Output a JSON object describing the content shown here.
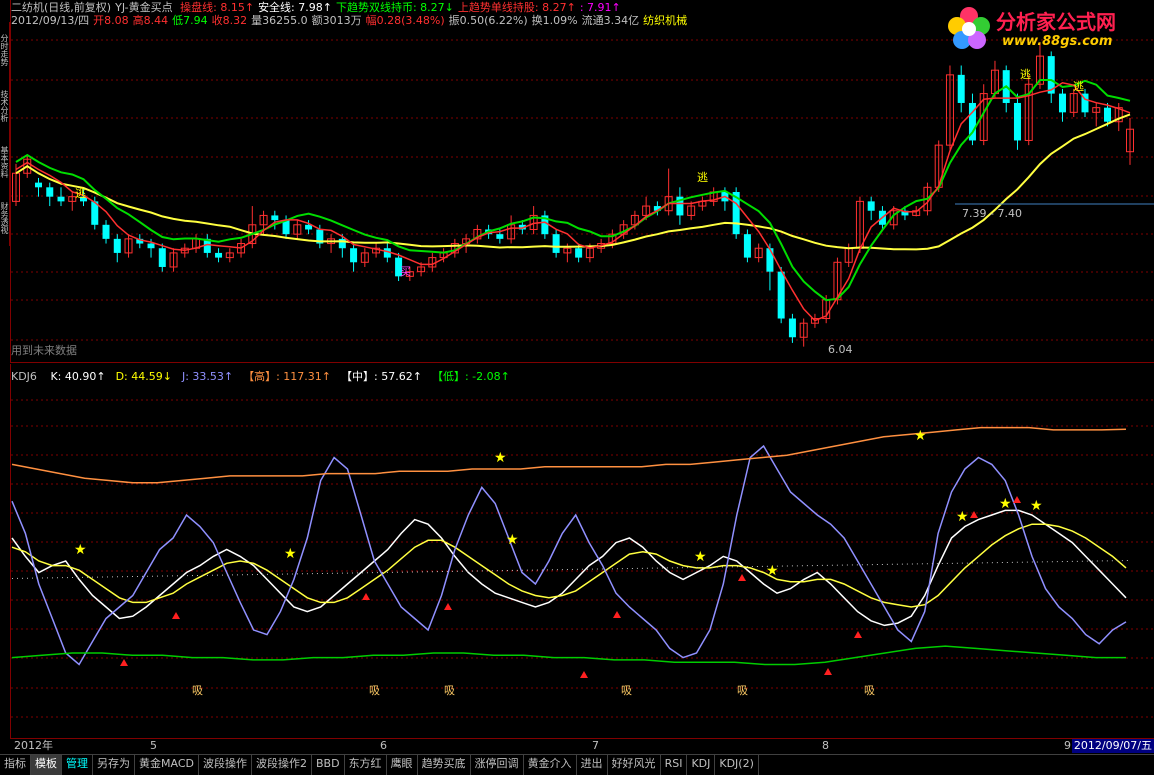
{
  "header": {
    "title": "二纺机(日线,前复权)",
    "indicator": "YJ-黄金买点",
    "items": [
      {
        "label": "操盘线:",
        "value": "8.15",
        "arrow": "↑",
        "color": "#ff3030"
      },
      {
        "label": "安全线:",
        "value": "7.98",
        "arrow": "↑",
        "color": "#ffffff"
      },
      {
        "label": "下趋势双线持币:",
        "value": "8.27",
        "arrow": "↓",
        "color": "#00ff00"
      },
      {
        "label": "上趋势单线持股:",
        "value": "8.27",
        "arrow": "↑",
        "color": "#ff3030"
      },
      {
        "label": ":",
        "value": "7.91",
        "arrow": "↑",
        "color": "#ff00ff"
      }
    ],
    "line2": [
      {
        "text": "2012/09/13/四",
        "color": "#c0c0c0"
      },
      {
        "text": "开8.08",
        "color": "#ff3030"
      },
      {
        "text": "高8.44",
        "color": "#ff3030"
      },
      {
        "text": "低7.94",
        "color": "#00ff00"
      },
      {
        "text": "收8.32",
        "color": "#ff3030"
      },
      {
        "text": "量36255.0",
        "color": "#c0c0c0"
      },
      {
        "text": "额3013万",
        "color": "#c0c0c0"
      },
      {
        "text": "幅0.28(3.48%)",
        "color": "#ff3030"
      },
      {
        "text": "振0.50(6.22%)",
        "color": "#c0c0c0"
      },
      {
        "text": "换1.09%",
        "color": "#c0c0c0"
      },
      {
        "text": "流通3.34亿",
        "color": "#c0c0c0"
      },
      {
        "text": "纺织机械",
        "color": "#ffff00"
      }
    ]
  },
  "side_tabs": [
    "分时走势",
    "技术分析",
    "基本资料",
    "财务透视"
  ],
  "main_annotations": {
    "future_note": "用到未来数据",
    "low_label": "6.04",
    "range_label": "7.39 - 7.40",
    "escape_labels": [
      "逃",
      "逃",
      "逃",
      "逃"
    ],
    "buy_label": "买"
  },
  "kdj_header": {
    "name": "KDJ6",
    "items": [
      {
        "label": "K:",
        "value": "40.90",
        "arrow": "↑",
        "color": "#ffffff"
      },
      {
        "label": "D:",
        "value": "44.59",
        "arrow": "↓",
        "color": "#ffff00"
      },
      {
        "label": "J:",
        "value": "33.53",
        "arrow": "↑",
        "color": "#9090ff"
      },
      {
        "label": "【高】:",
        "value": "117.31",
        "arrow": "↑",
        "color": "#ff9040"
      },
      {
        "label": "【中】:",
        "value": "57.62",
        "arrow": "↑",
        "color": "#ffffff"
      },
      {
        "label": "【低】:",
        "value": "-2.08",
        "arrow": "↑",
        "color": "#00ff00"
      }
    ],
    "xi_label": "吸"
  },
  "date_axis": {
    "labels": [
      "2012年",
      "5",
      "6",
      "7",
      "8",
      "9"
    ],
    "current_date": "2012/09/07/五"
  },
  "bottom_tabs": [
    "指标",
    "模板",
    "管理",
    "另存为",
    "黄金MACD",
    "波段操作",
    "波段操作2",
    "BBD",
    "东方红",
    "鹰眼",
    "趋势买底",
    "涨停回调",
    "黄金介入",
    "进出",
    "好好风光",
    "RSI",
    "KDJ",
    "KDJ(2)"
  ],
  "logo": {
    "text": "分析家公式网",
    "url_text": "www.88gs.com"
  },
  "colors": {
    "up": "#ff3030",
    "down": "#00ffff",
    "ma_yellow": "#ffff40",
    "green": "#00dd00",
    "grid": "#800000"
  },
  "chart_data": [
    {
      "type": "candlestick",
      "title": "二纺机(日线,前复权)",
      "ylim": [
        5.9,
        9.4
      ],
      "note": "approximate OHLC sequence, Apr–Sep 2012",
      "candles": [
        [
          7.55,
          7.85,
          7.95,
          7.5
        ],
        [
          7.85,
          8.0,
          8.05,
          7.8
        ],
        [
          7.75,
          7.7,
          7.8,
          7.6
        ],
        [
          7.7,
          7.6,
          7.75,
          7.5
        ],
        [
          7.6,
          7.55,
          7.7,
          7.5
        ],
        [
          7.55,
          7.6,
          7.65,
          7.45
        ],
        [
          7.6,
          7.55,
          7.7,
          7.5
        ],
        [
          7.55,
          7.3,
          7.6,
          7.25
        ],
        [
          7.3,
          7.15,
          7.35,
          7.1
        ],
        [
          7.15,
          7.0,
          7.2,
          6.9
        ],
        [
          7.0,
          7.15,
          7.2,
          6.95
        ],
        [
          7.15,
          7.1,
          7.2,
          7.05
        ],
        [
          7.1,
          7.05,
          7.15,
          6.95
        ],
        [
          7.05,
          6.85,
          7.1,
          6.8
        ],
        [
          6.85,
          7.0,
          7.05,
          6.8
        ],
        [
          7.0,
          7.05,
          7.1,
          6.95
        ],
        [
          7.05,
          7.15,
          7.2,
          7.0
        ],
        [
          7.15,
          7.0,
          7.2,
          6.95
        ],
        [
          7.0,
          6.95,
          7.05,
          6.9
        ],
        [
          6.95,
          7.0,
          7.05,
          6.9
        ],
        [
          7.0,
          7.1,
          7.15,
          6.95
        ],
        [
          7.1,
          7.3,
          7.5,
          7.05
        ],
        [
          7.3,
          7.4,
          7.45,
          7.2
        ],
        [
          7.4,
          7.35,
          7.45,
          7.25
        ],
        [
          7.35,
          7.2,
          7.4,
          7.15
        ],
        [
          7.2,
          7.3,
          7.35,
          7.15
        ],
        [
          7.3,
          7.25,
          7.35,
          7.2
        ],
        [
          7.25,
          7.1,
          7.3,
          7.05
        ],
        [
          7.1,
          7.15,
          7.2,
          7.0
        ],
        [
          7.15,
          7.05,
          7.2,
          6.95
        ],
        [
          7.05,
          6.9,
          7.1,
          6.8
        ],
        [
          6.9,
          7.0,
          7.05,
          6.85
        ],
        [
          7.0,
          7.05,
          7.1,
          6.95
        ],
        [
          7.05,
          6.95,
          7.1,
          6.9
        ],
        [
          6.95,
          6.75,
          7.0,
          6.7
        ],
        [
          6.75,
          6.8,
          6.85,
          6.7
        ],
        [
          6.8,
          6.85,
          6.9,
          6.75
        ],
        [
          6.85,
          6.95,
          7.0,
          6.8
        ],
        [
          6.95,
          7.0,
          7.05,
          6.9
        ],
        [
          7.0,
          7.1,
          7.15,
          6.95
        ],
        [
          7.1,
          7.15,
          7.2,
          7.0
        ],
        [
          7.15,
          7.25,
          7.3,
          7.1
        ],
        [
          7.25,
          7.2,
          7.3,
          7.15
        ],
        [
          7.2,
          7.15,
          7.25,
          7.1
        ],
        [
          7.15,
          7.3,
          7.4,
          7.1
        ],
        [
          7.3,
          7.25,
          7.35,
          7.2
        ],
        [
          7.25,
          7.4,
          7.5,
          7.2
        ],
        [
          7.4,
          7.2,
          7.45,
          7.15
        ],
        [
          7.2,
          7.0,
          7.25,
          6.95
        ],
        [
          7.0,
          7.05,
          7.1,
          6.9
        ],
        [
          7.05,
          6.95,
          7.1,
          6.9
        ],
        [
          6.95,
          7.05,
          7.1,
          6.9
        ],
        [
          7.05,
          7.1,
          7.15,
          7.0
        ],
        [
          7.1,
          7.2,
          7.25,
          7.05
        ],
        [
          7.2,
          7.3,
          7.35,
          7.15
        ],
        [
          7.3,
          7.4,
          7.45,
          7.25
        ],
        [
          7.4,
          7.5,
          7.6,
          7.35
        ],
        [
          7.5,
          7.45,
          7.55,
          7.4
        ],
        [
          7.45,
          7.6,
          7.9,
          7.4
        ],
        [
          7.6,
          7.4,
          7.7,
          7.3
        ],
        [
          7.4,
          7.5,
          7.55,
          7.35
        ],
        [
          7.5,
          7.55,
          7.6,
          7.45
        ],
        [
          7.55,
          7.65,
          7.7,
          7.5
        ],
        [
          7.65,
          7.55,
          7.7,
          7.45
        ],
        [
          7.65,
          7.2,
          7.7,
          7.15
        ],
        [
          7.2,
          6.95,
          7.25,
          6.9
        ],
        [
          6.95,
          7.05,
          7.1,
          6.9
        ],
        [
          7.05,
          6.8,
          7.1,
          6.6
        ],
        [
          6.8,
          6.3,
          6.85,
          6.25
        ],
        [
          6.3,
          6.1,
          6.35,
          6.04
        ],
        [
          6.1,
          6.25,
          6.3,
          6.0
        ],
        [
          6.25,
          6.3,
          6.35,
          6.2
        ],
        [
          6.3,
          6.5,
          6.55,
          6.25
        ],
        [
          6.5,
          6.9,
          6.95,
          6.45
        ],
        [
          6.9,
          7.05,
          7.1,
          6.85
        ],
        [
          7.05,
          7.55,
          7.6,
          7.0
        ],
        [
          7.55,
          7.45,
          7.6,
          7.35
        ],
        [
          7.45,
          7.3,
          7.5,
          7.25
        ],
        [
          7.3,
          7.45,
          7.5,
          7.25
        ],
        [
          7.45,
          7.4,
          7.5,
          7.35
        ],
        [
          7.4,
          7.45,
          7.5,
          7.39
        ],
        [
          7.45,
          7.7,
          7.75,
          7.4
        ],
        [
          7.7,
          8.15,
          8.2,
          7.65
        ],
        [
          8.15,
          8.9,
          9.0,
          8.1
        ],
        [
          8.9,
          8.6,
          9.0,
          8.5
        ],
        [
          8.6,
          8.2,
          8.7,
          8.15
        ],
        [
          8.2,
          8.7,
          8.8,
          8.15
        ],
        [
          8.7,
          8.95,
          9.05,
          8.65
        ],
        [
          8.95,
          8.6,
          9.0,
          8.5
        ],
        [
          8.6,
          8.2,
          8.7,
          8.1
        ],
        [
          8.2,
          8.8,
          8.9,
          8.15
        ],
        [
          8.8,
          9.1,
          9.25,
          8.75
        ],
        [
          9.1,
          8.7,
          9.15,
          8.6
        ],
        [
          8.7,
          8.5,
          8.75,
          8.4
        ],
        [
          8.5,
          8.7,
          8.75,
          8.45
        ],
        [
          8.7,
          8.5,
          8.75,
          8.45
        ],
        [
          8.5,
          8.55,
          8.6,
          8.35
        ],
        [
          8.55,
          8.4,
          8.6,
          8.35
        ],
        [
          8.4,
          8.55,
          8.6,
          8.3
        ],
        [
          8.08,
          8.32,
          8.44,
          7.94
        ]
      ]
    },
    {
      "type": "line",
      "title": "KDJ6",
      "ylim": [
        -10,
        130
      ],
      "series": [
        {
          "name": "K",
          "values": [
            70,
            62,
            55,
            58,
            60,
            52,
            45,
            40,
            35,
            36,
            40,
            45,
            50,
            55,
            58,
            62,
            65,
            62,
            58,
            52,
            46,
            40,
            38,
            40,
            45,
            50,
            55,
            60,
            65,
            72,
            78,
            76,
            70,
            62,
            55,
            50,
            46,
            44,
            42,
            40,
            42,
            46,
            52,
            58,
            62,
            68,
            70,
            66,
            60,
            55,
            52,
            55,
            58,
            62,
            60,
            55,
            50,
            46,
            48,
            52,
            55,
            50,
            44,
            38,
            34,
            32,
            33,
            36,
            45,
            58,
            70,
            75,
            78,
            80,
            82,
            82,
            80,
            76,
            72,
            68,
            62,
            56,
            50,
            44
          ]
        },
        {
          "name": "D",
          "values": [
            66,
            64,
            60,
            58,
            58,
            56,
            52,
            48,
            44,
            42,
            42,
            44,
            46,
            50,
            53,
            56,
            59,
            60,
            59,
            56,
            52,
            48,
            44,
            42,
            42,
            44,
            48,
            52,
            56,
            61,
            66,
            69,
            69,
            66,
            62,
            58,
            54,
            50,
            47,
            45,
            44,
            45,
            47,
            51,
            55,
            59,
            63,
            64,
            63,
            60,
            58,
            57,
            57,
            58,
            58,
            57,
            55,
            52,
            51,
            51,
            52,
            52,
            50,
            47,
            44,
            42,
            41,
            40,
            41,
            45,
            51,
            57,
            62,
            67,
            71,
            74,
            76,
            76,
            75,
            73,
            70,
            66,
            62,
            57
          ]
        },
        {
          "name": "J",
          "values": [
            86,
            72,
            50,
            35,
            20,
            15,
            25,
            35,
            40,
            45,
            55,
            65,
            70,
            80,
            75,
            68,
            55,
            42,
            30,
            28,
            38,
            52,
            70,
            95,
            105,
            100,
            80,
            60,
            50,
            40,
            35,
            30,
            45,
            65,
            80,
            92,
            85,
            70,
            55,
            50,
            60,
            72,
            80,
            68,
            58,
            46,
            40,
            35,
            30,
            22,
            18,
            20,
            30,
            50,
            80,
            105,
            110,
            100,
            90,
            85,
            80,
            76,
            70,
            60,
            50,
            40,
            30,
            25,
            38,
            72,
            90,
            100,
            105,
            102,
            95,
            80,
            62,
            48,
            40,
            35,
            28,
            24,
            30,
            33.53
          ]
        },
        {
          "name": "高",
          "values": [
            102,
            100,
            98,
            96,
            95,
            94,
            94,
            95,
            96,
            97,
            97,
            97,
            97,
            98,
            98,
            98,
            99,
            99,
            99,
            100,
            100,
            100,
            101,
            101,
            101,
            101,
            101,
            102,
            102,
            103,
            104,
            105,
            106,
            108,
            110,
            112,
            114,
            115,
            116,
            117,
            118,
            118,
            118,
            117,
            117,
            117,
            117.31
          ]
        },
        {
          "name": "低",
          "values": [
            18,
            19,
            20,
            20,
            19,
            19,
            18,
            18,
            17,
            17,
            18,
            18,
            19,
            19,
            20,
            20,
            19,
            19,
            18,
            18,
            17,
            17,
            16,
            16,
            16,
            15,
            15,
            16,
            18,
            20,
            22,
            23,
            22,
            21,
            20,
            19,
            18,
            18
          ]
        }
      ]
    }
  ]
}
